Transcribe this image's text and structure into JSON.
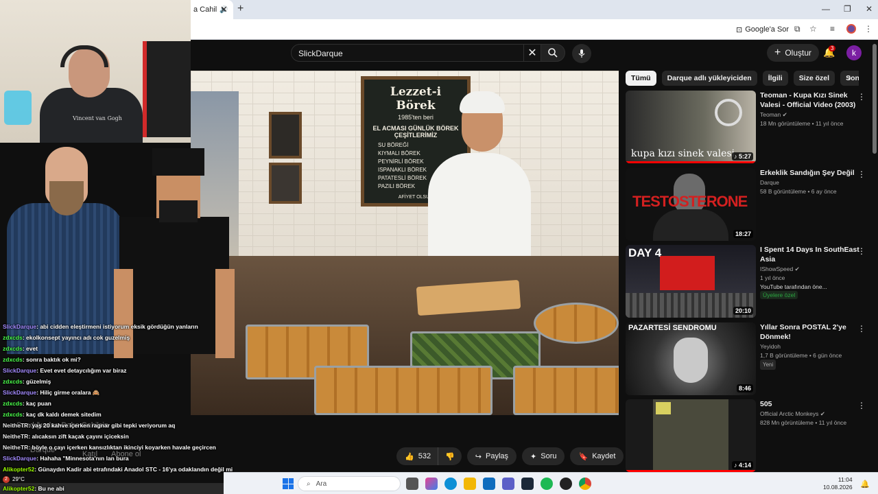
{
  "browser": {
    "tab_title": "a Cahil",
    "tab_close": "✕",
    "new_tab": "+",
    "ask_google": "Google'a Sor",
    "win_min": "—",
    "win_max": "❐",
    "win_close": "✕"
  },
  "youtube": {
    "search_value": "SlickDarque",
    "search_clear": "✕",
    "create_label": "Oluştur",
    "notif_count": "3",
    "avatar_letter": "k"
  },
  "video": {
    "board": {
      "title": "Lezzet-i Börek",
      "since": "1985'ten beri",
      "heading": "EL ACMASI GÜNLÜK BÖREK ÇEŞİTLERİMİZ",
      "items": [
        "SU BÖREĞİ",
        "KIYMALI BÖREK",
        "PEYNİRLİ BÖREK",
        "ISPANAKLI BÖREK",
        "PATATESLİ BÖREK",
        "PAZILI BÖREK"
      ],
      "footer": "AFİYET OLSUN"
    },
    "actions": {
      "likes": "532",
      "share": "Paylaş",
      "ask": "Soru",
      "save": "Kaydet"
    }
  },
  "chips": [
    "Tümü",
    "Darque adlı yükleyiciden",
    "İlgili",
    "Size özel",
    "Son yükle"
  ],
  "related": [
    {
      "title": "Teoman - Kupa Kızı Sinek Valesi - Official Video (2003)",
      "channel": "Teoman",
      "verified": true,
      "meta": "18 Mn görüntüleme • 11 yıl önce",
      "duration": "5:27",
      "thumb_text": "kupa kızı sinek valesi",
      "has_mix_icon": true
    },
    {
      "title": "Erkeklik Sandığın Şey Değil",
      "channel": "Darque",
      "verified": false,
      "meta": "58 B görüntüleme • 6 ay önce",
      "duration": "18:27",
      "thumb_text": "TESTOSTERONE"
    },
    {
      "title": "I Spent 14 Days In SouthEast Asia",
      "channel": "IShowSpeed",
      "verified": true,
      "meta": "1 yıl önce",
      "extra": "YouTube tarafından öne...",
      "member": "Üyelere özel",
      "duration": "20:10",
      "thumb_text": "DAY 4"
    },
    {
      "title": "Yıllar Sonra POSTAL 2'ye Dönmek!",
      "channel": "Yeyidoh",
      "verified": false,
      "meta": "1,7 B görüntüleme • 6 gün önce",
      "badge": "Yeni",
      "duration": "8:46",
      "thumb_text": "PAZARTESİ SENDROMU"
    },
    {
      "title": "505",
      "channel": "Official Arctic Monkeys",
      "verified": true,
      "meta": "828 Mn görüntüleme • 11 yıl önce",
      "duration": "4:14",
      "has_mix_icon": true
    }
  ],
  "webcam": {
    "shirt_text": "Vincent van Gogh"
  },
  "chat": [
    {
      "user": "SlickDarque",
      "color": "purple",
      "msg": ": abi cidden eleştirmeni istiyorum eksik gördüğün yanların"
    },
    {
      "user": "zdxcds",
      "color": "green",
      "msg": ": ekolkonsept yayıncı adı cok guzelmiş"
    },
    {
      "user": "zdxcds",
      "color": "green",
      "msg": ": evet"
    },
    {
      "user": "zdxcds",
      "color": "green",
      "msg": ": sonra baktık ok mi?"
    },
    {
      "user": "SlickDarque",
      "color": "purple",
      "msg": ": Evet evet detaycılığım var biraz"
    },
    {
      "user": "zdxcds",
      "color": "green",
      "msg": ": güzelmiş"
    },
    {
      "user": "SlickDarque",
      "color": "purple",
      "msg": ": Hiliç girme oralara 🙈"
    },
    {
      "user": "zdxcds",
      "color": "green",
      "msg": ": kaç puan"
    },
    {
      "user": "zdxcds",
      "color": "green",
      "msg": ": kaç dk kaldı demek sitedim"
    },
    {
      "user": "NeitheTR",
      "color": "white",
      "msg": ": yaş 20 kahve içerken ragnar gibi tepki veriyorum aq"
    },
    {
      "user": "NeitheTR",
      "color": "white",
      "msg": ": alıcaksın zift kaçak çayını içiceksin"
    },
    {
      "user": "NeitheTR",
      "color": "white",
      "msg": ": böyle o çayı içerken kansızlıktan ikinciyi koyarken havale geçircen"
    },
    {
      "user": "SlickDarque",
      "color": "purple",
      "msg": ": Hahaha \"Minnesota'nın lan bura"
    },
    {
      "user": "Alikopter52",
      "color": "lime",
      "msg": ": Günaydın Kadir abi etrafındaki Anadol STC - 16'ya odaklandın değil mi"
    },
    {
      "user": "Alikopter52",
      "color": "lime",
      "msg": ": Bu ne abi"
    }
  ],
  "ghost_text": {
    "line1": "Sandığından Daha Cahilsin",
    "line2": "Darque",
    "line3": "Katıl",
    "line4": "Abone ol"
  },
  "weather": {
    "temp": "29°C",
    "badge": "2"
  },
  "taskbar": {
    "search_placeholder": "Ara",
    "time": "11:04",
    "date": "10.08.2026"
  }
}
